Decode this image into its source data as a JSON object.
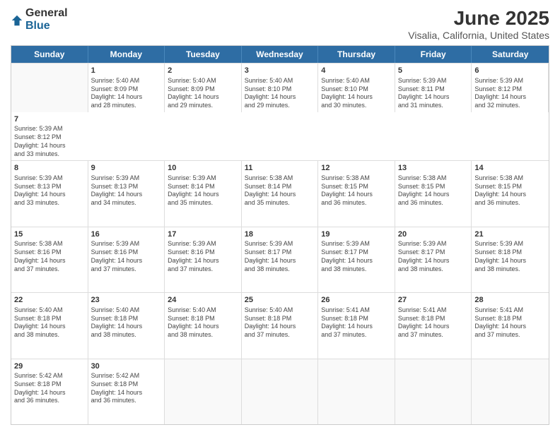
{
  "logo": {
    "general": "General",
    "blue": "Blue"
  },
  "title": "June 2025",
  "subtitle": "Visalia, California, United States",
  "days": [
    "Sunday",
    "Monday",
    "Tuesday",
    "Wednesday",
    "Thursday",
    "Friday",
    "Saturday"
  ],
  "rows": [
    [
      {
        "day": "",
        "empty": true
      },
      {
        "day": "1",
        "line1": "Sunrise: 5:40 AM",
        "line2": "Sunset: 8:09 PM",
        "line3": "Daylight: 14 hours",
        "line4": "and 28 minutes."
      },
      {
        "day": "2",
        "line1": "Sunrise: 5:40 AM",
        "line2": "Sunset: 8:09 PM",
        "line3": "Daylight: 14 hours",
        "line4": "and 29 minutes."
      },
      {
        "day": "3",
        "line1": "Sunrise: 5:40 AM",
        "line2": "Sunset: 8:10 PM",
        "line3": "Daylight: 14 hours",
        "line4": "and 29 minutes."
      },
      {
        "day": "4",
        "line1": "Sunrise: 5:40 AM",
        "line2": "Sunset: 8:10 PM",
        "line3": "Daylight: 14 hours",
        "line4": "and 30 minutes."
      },
      {
        "day": "5",
        "line1": "Sunrise: 5:39 AM",
        "line2": "Sunset: 8:11 PM",
        "line3": "Daylight: 14 hours",
        "line4": "and 31 minutes."
      },
      {
        "day": "6",
        "line1": "Sunrise: 5:39 AM",
        "line2": "Sunset: 8:12 PM",
        "line3": "Daylight: 14 hours",
        "line4": "and 32 minutes."
      },
      {
        "day": "7",
        "line1": "Sunrise: 5:39 AM",
        "line2": "Sunset: 8:12 PM",
        "line3": "Daylight: 14 hours",
        "line4": "and 33 minutes."
      }
    ],
    [
      {
        "day": "8",
        "line1": "Sunrise: 5:39 AM",
        "line2": "Sunset: 8:13 PM",
        "line3": "Daylight: 14 hours",
        "line4": "and 33 minutes."
      },
      {
        "day": "9",
        "line1": "Sunrise: 5:39 AM",
        "line2": "Sunset: 8:13 PM",
        "line3": "Daylight: 14 hours",
        "line4": "and 34 minutes."
      },
      {
        "day": "10",
        "line1": "Sunrise: 5:39 AM",
        "line2": "Sunset: 8:14 PM",
        "line3": "Daylight: 14 hours",
        "line4": "and 35 minutes."
      },
      {
        "day": "11",
        "line1": "Sunrise: 5:38 AM",
        "line2": "Sunset: 8:14 PM",
        "line3": "Daylight: 14 hours",
        "line4": "and 35 minutes."
      },
      {
        "day": "12",
        "line1": "Sunrise: 5:38 AM",
        "line2": "Sunset: 8:15 PM",
        "line3": "Daylight: 14 hours",
        "line4": "and 36 minutes."
      },
      {
        "day": "13",
        "line1": "Sunrise: 5:38 AM",
        "line2": "Sunset: 8:15 PM",
        "line3": "Daylight: 14 hours",
        "line4": "and 36 minutes."
      },
      {
        "day": "14",
        "line1": "Sunrise: 5:38 AM",
        "line2": "Sunset: 8:15 PM",
        "line3": "Daylight: 14 hours",
        "line4": "and 36 minutes."
      }
    ],
    [
      {
        "day": "15",
        "line1": "Sunrise: 5:38 AM",
        "line2": "Sunset: 8:16 PM",
        "line3": "Daylight: 14 hours",
        "line4": "and 37 minutes."
      },
      {
        "day": "16",
        "line1": "Sunrise: 5:39 AM",
        "line2": "Sunset: 8:16 PM",
        "line3": "Daylight: 14 hours",
        "line4": "and 37 minutes."
      },
      {
        "day": "17",
        "line1": "Sunrise: 5:39 AM",
        "line2": "Sunset: 8:16 PM",
        "line3": "Daylight: 14 hours",
        "line4": "and 37 minutes."
      },
      {
        "day": "18",
        "line1": "Sunrise: 5:39 AM",
        "line2": "Sunset: 8:17 PM",
        "line3": "Daylight: 14 hours",
        "line4": "and 38 minutes."
      },
      {
        "day": "19",
        "line1": "Sunrise: 5:39 AM",
        "line2": "Sunset: 8:17 PM",
        "line3": "Daylight: 14 hours",
        "line4": "and 38 minutes."
      },
      {
        "day": "20",
        "line1": "Sunrise: 5:39 AM",
        "line2": "Sunset: 8:17 PM",
        "line3": "Daylight: 14 hours",
        "line4": "and 38 minutes."
      },
      {
        "day": "21",
        "line1": "Sunrise: 5:39 AM",
        "line2": "Sunset: 8:18 PM",
        "line3": "Daylight: 14 hours",
        "line4": "and 38 minutes."
      }
    ],
    [
      {
        "day": "22",
        "line1": "Sunrise: 5:40 AM",
        "line2": "Sunset: 8:18 PM",
        "line3": "Daylight: 14 hours",
        "line4": "and 38 minutes."
      },
      {
        "day": "23",
        "line1": "Sunrise: 5:40 AM",
        "line2": "Sunset: 8:18 PM",
        "line3": "Daylight: 14 hours",
        "line4": "and 38 minutes."
      },
      {
        "day": "24",
        "line1": "Sunrise: 5:40 AM",
        "line2": "Sunset: 8:18 PM",
        "line3": "Daylight: 14 hours",
        "line4": "and 38 minutes."
      },
      {
        "day": "25",
        "line1": "Sunrise: 5:40 AM",
        "line2": "Sunset: 8:18 PM",
        "line3": "Daylight: 14 hours",
        "line4": "and 37 minutes."
      },
      {
        "day": "26",
        "line1": "Sunrise: 5:41 AM",
        "line2": "Sunset: 8:18 PM",
        "line3": "Daylight: 14 hours",
        "line4": "and 37 minutes."
      },
      {
        "day": "27",
        "line1": "Sunrise: 5:41 AM",
        "line2": "Sunset: 8:18 PM",
        "line3": "Daylight: 14 hours",
        "line4": "and 37 minutes."
      },
      {
        "day": "28",
        "line1": "Sunrise: 5:41 AM",
        "line2": "Sunset: 8:18 PM",
        "line3": "Daylight: 14 hours",
        "line4": "and 37 minutes."
      }
    ],
    [
      {
        "day": "29",
        "line1": "Sunrise: 5:42 AM",
        "line2": "Sunset: 8:18 PM",
        "line3": "Daylight: 14 hours",
        "line4": "and 36 minutes."
      },
      {
        "day": "30",
        "line1": "Sunrise: 5:42 AM",
        "line2": "Sunset: 8:18 PM",
        "line3": "Daylight: 14 hours",
        "line4": "and 36 minutes."
      },
      {
        "day": "",
        "empty": true
      },
      {
        "day": "",
        "empty": true
      },
      {
        "day": "",
        "empty": true
      },
      {
        "day": "",
        "empty": true
      },
      {
        "day": "",
        "empty": true
      }
    ]
  ]
}
